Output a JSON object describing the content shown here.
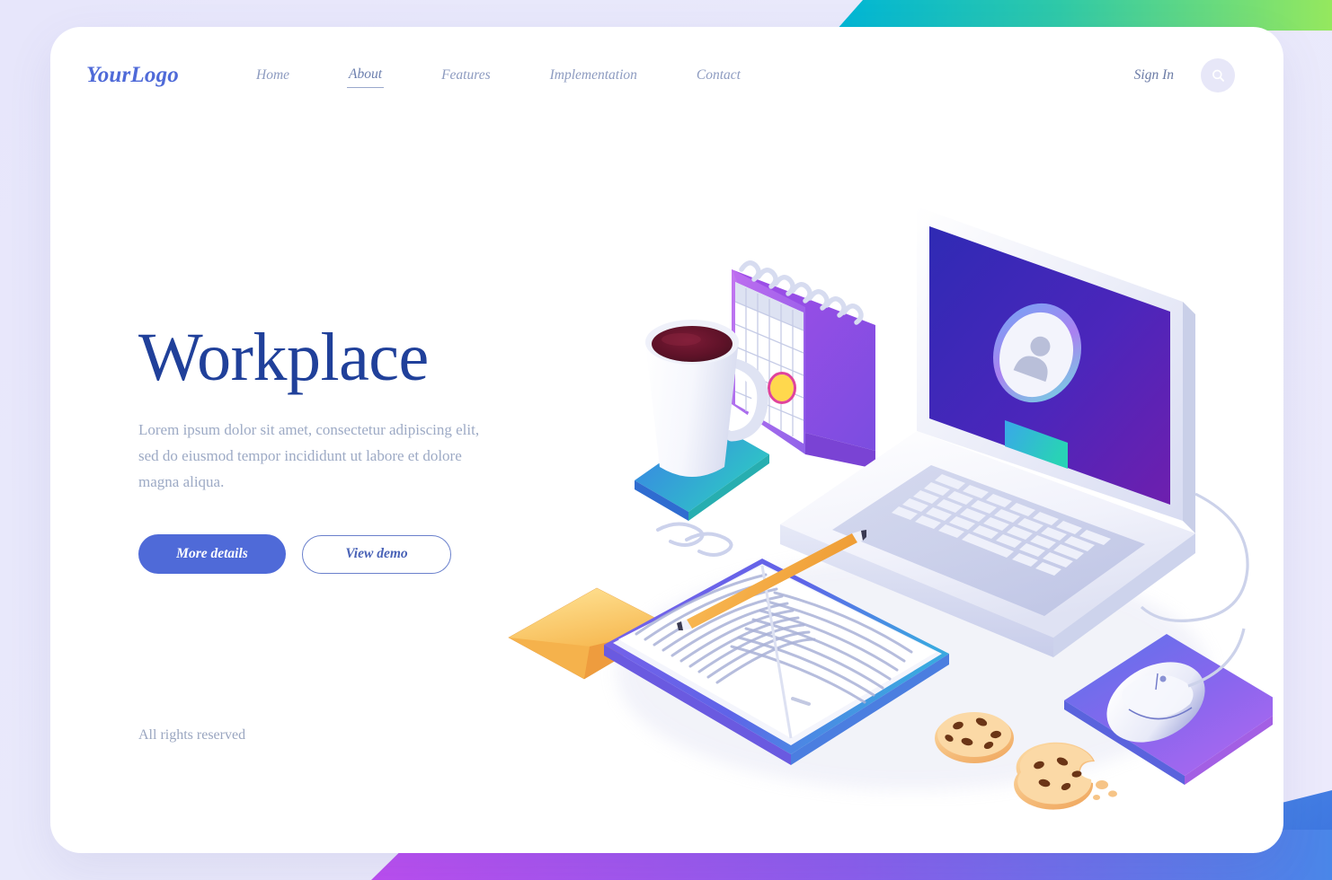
{
  "page": {
    "background_color": "#e7e6fb",
    "card_color": "#ffffff",
    "accent_color": "#4f6ad8",
    "title_color": "#20409a"
  },
  "header": {
    "logo": "YourLogo",
    "nav": [
      {
        "label": "Home",
        "active": false
      },
      {
        "label": "About",
        "active": true
      },
      {
        "label": "Features",
        "active": false
      },
      {
        "label": "Implementation",
        "active": false
      },
      {
        "label": "Contact",
        "active": false
      }
    ],
    "sign_in_label": "Sign In",
    "search_icon": "search-icon"
  },
  "hero": {
    "title": "Workplace",
    "description": "Lorem ipsum dolor sit amet, consectetur adipiscing elit, sed do eiusmod tempor incididunt ut labore et dolore magna aliqua.",
    "primary_button": "More details",
    "secondary_button": "View demo"
  },
  "footer": {
    "rights": "All rights reserved"
  },
  "illustration": {
    "name": "isometric-workplace-desk-scene",
    "objects": [
      "laptop-with-login-screen",
      "user-avatar-icon",
      "login-button",
      "coffee-mug",
      "coaster",
      "desk-calendar",
      "calendar-marked-date",
      "paper-clips",
      "envelope",
      "open-notebook",
      "pencil",
      "computer-mouse",
      "mouse-pad",
      "cookie",
      "bitten-cookie"
    ],
    "colors": {
      "screen_gradient_from": "#2e2bb0",
      "screen_gradient_to": "#6b1fae",
      "login_button_from": "#3aa9e8",
      "login_button_to": "#2ad0b8",
      "coaster_from": "#3c7ee8",
      "coaster_to": "#2ec6c6",
      "mousepad_from": "#5a73e8",
      "mousepad_to": "#b martin"
    }
  },
  "decorations": {
    "top_band_from": "#00b8d4",
    "top_band_to": "#8ce563",
    "bottom_band_from": "#b34ae8",
    "bottom_band_to": "#4f6ad8",
    "right_panel_color": "#3d7ae0"
  }
}
